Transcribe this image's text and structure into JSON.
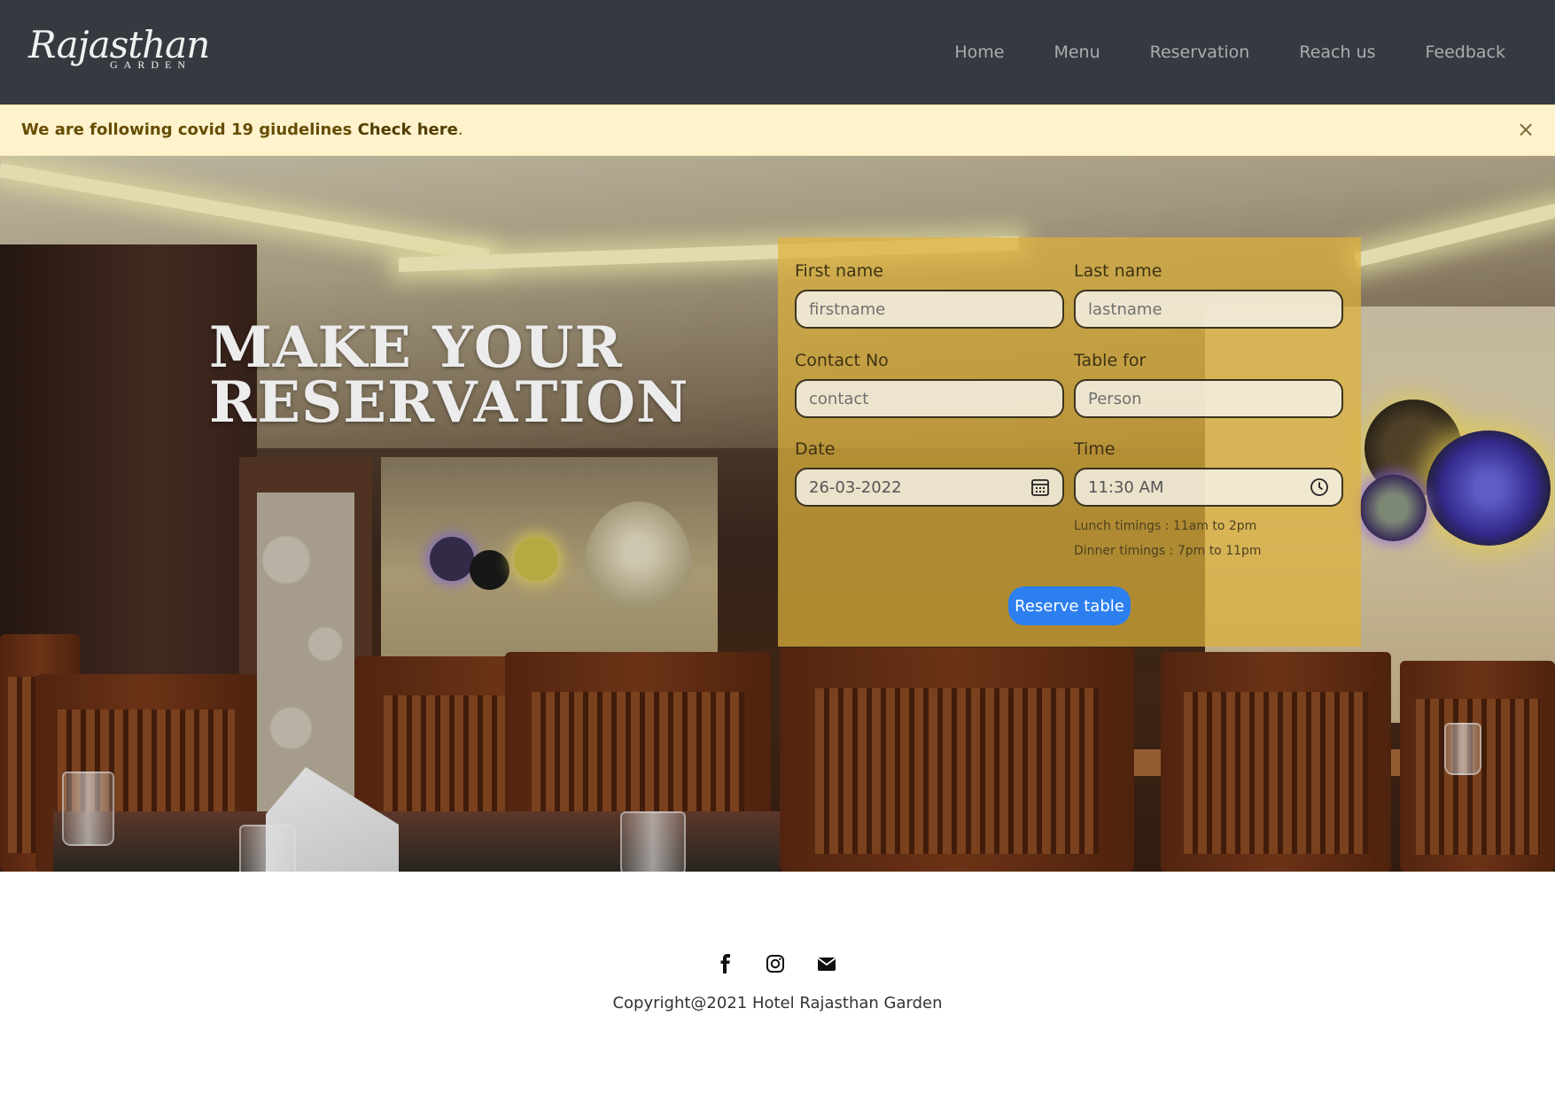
{
  "brand": {
    "logo_script": "Rajasthan",
    "logo_sub": "GARDEN"
  },
  "nav": {
    "items": [
      {
        "label": "Home"
      },
      {
        "label": "Menu"
      },
      {
        "label": "Reservation"
      },
      {
        "label": "Reach us"
      },
      {
        "label": "Feedback"
      }
    ]
  },
  "alert": {
    "text": "We are following covid 19 giudelines ",
    "link": "Check here",
    "suffix": ".",
    "close": "×"
  },
  "hero": {
    "title_line1": "MAKE YOUR",
    "title_line2": "RESERVATION"
  },
  "form": {
    "first_name": {
      "label": "First name",
      "placeholder": "firstname",
      "value": ""
    },
    "last_name": {
      "label": "Last name",
      "placeholder": "lastname",
      "value": ""
    },
    "contact": {
      "label": "Contact No",
      "placeholder": "contact",
      "value": ""
    },
    "table_for": {
      "label": "Table for",
      "placeholder": "Person",
      "value": ""
    },
    "date": {
      "label": "Date",
      "value": "26-03-2022",
      "icon": "calendar-icon"
    },
    "time": {
      "label": "Time",
      "value": "11:30 AM",
      "icon": "clock-icon"
    },
    "hint_lunch": "Lunch timings : 11am to 2pm",
    "hint_dinner": "Dinner timings : 7pm to 11pm",
    "submit_label": "Reserve table"
  },
  "footer": {
    "icons": [
      "facebook-icon",
      "instagram-icon",
      "email-icon"
    ],
    "copyright": "Copyright@2021 Hotel Rajasthan Garden"
  },
  "colors": {
    "navbar": "#343a40",
    "alert_bg": "#fff3cd",
    "form_card": "#deb23c",
    "button": "#2d7ff0"
  }
}
